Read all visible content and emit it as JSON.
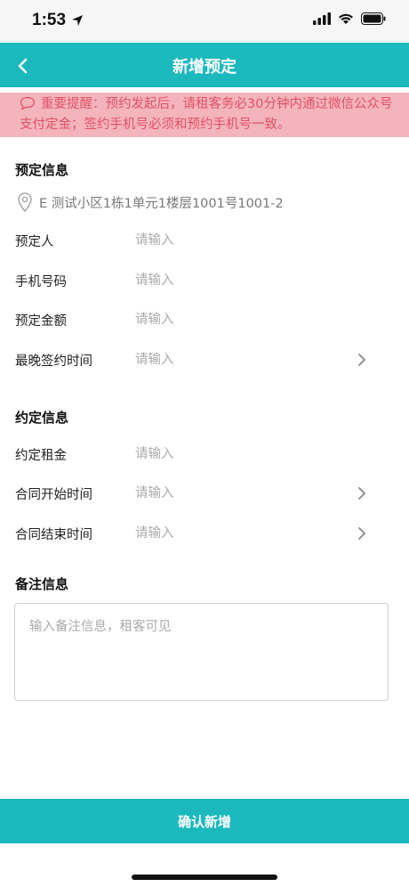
{
  "status_bar": {
    "time": "1:53"
  },
  "nav": {
    "title": "新增预定",
    "back_icon": "chevron-left-icon"
  },
  "notice": {
    "text": "重要提醒：预约发起后，请租客务必30分钟内通过微信公众号支付定金；签约手机号必须和预约手机号一致。"
  },
  "booking_info": {
    "title": "预定信息",
    "address": "E 测试小区1栋1单元1楼层1001号1001-2",
    "fields": [
      {
        "label": "预定人",
        "placeholder": "请输入",
        "has_chevron": false
      },
      {
        "label": "手机号码",
        "placeholder": "请输入",
        "has_chevron": false
      },
      {
        "label": "预定金额",
        "placeholder": "请输入",
        "has_chevron": false
      },
      {
        "label": "最晚签约时间",
        "placeholder": "请输入",
        "has_chevron": true
      }
    ]
  },
  "agreement_info": {
    "title": "约定信息",
    "fields": [
      {
        "label": "约定租金",
        "placeholder": "请输入",
        "has_chevron": false
      },
      {
        "label": "合同开始时间",
        "placeholder": "请输入",
        "has_chevron": true
      },
      {
        "label": "合同结束时间",
        "placeholder": "请输入",
        "has_chevron": true
      }
    ]
  },
  "remarks": {
    "title": "备注信息",
    "placeholder": "输入备注信息，租客可见"
  },
  "footer": {
    "confirm_label": "确认新增"
  },
  "colors": {
    "primary": "#1bb9bd",
    "notice_bg": "#f4b4bb",
    "notice_text": "#e0526a"
  }
}
